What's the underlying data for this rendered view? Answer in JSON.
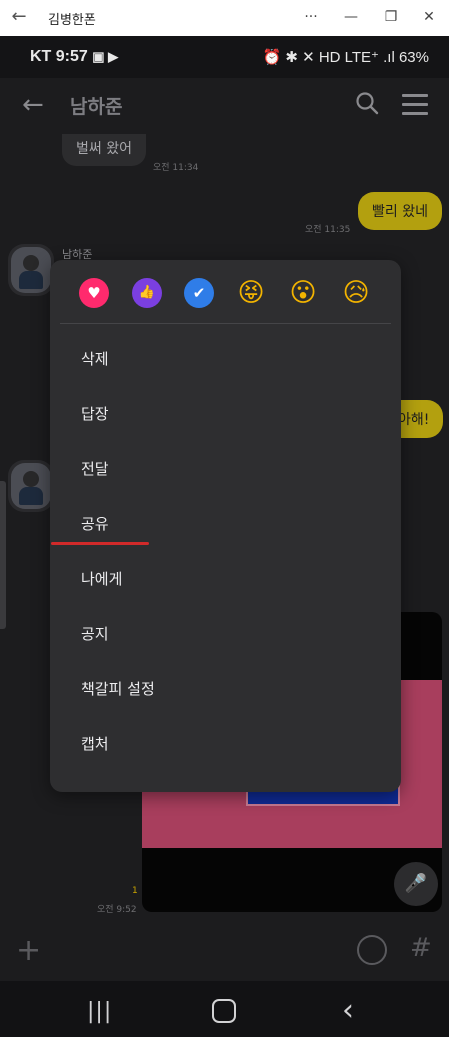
{
  "window": {
    "title": "김병한폰",
    "controls": [
      "···",
      "—",
      "❐",
      "✕"
    ],
    "back_icon": "←"
  },
  "status_bar": {
    "carrier": "KT",
    "time": "9:57",
    "right": "⏰ ✱ ✕ HD LTE⁺ .ıl 63%"
  },
  "chat": {
    "title": "남하준",
    "messages": {
      "left1": {
        "text": "벌써 왔어",
        "time": "오전 11:34"
      },
      "right1": {
        "text": "빨리 왔네",
        "time": "오전 11:35"
      },
      "sender_name": "남하준",
      "right2_partial": "아해!",
      "image_unread": "1",
      "image_time": "오전 9:52"
    }
  },
  "context_menu": {
    "reactions": [
      {
        "name": "heart",
        "glyph": "♥",
        "color": "#ff2a6d"
      },
      {
        "name": "thumbs-up",
        "glyph": "👍",
        "color": "#7b3fe0"
      },
      {
        "name": "check",
        "glyph": "✔",
        "color": "#2f7de8"
      },
      {
        "name": "laugh",
        "glyph": "😝",
        "color": "#f3b400"
      },
      {
        "name": "surprised",
        "glyph": "😮",
        "color": "#f3b400"
      },
      {
        "name": "sad",
        "glyph": "😥",
        "color": "#f3b400"
      }
    ],
    "items": [
      "삭제",
      "답장",
      "전달",
      "공유",
      "나에게",
      "공지",
      "책갈피 설정",
      "캡처"
    ]
  },
  "input_bar": {
    "plus": "+",
    "hash": "#"
  },
  "nav_bar": {
    "recent": "|||",
    "back": "‹"
  },
  "colors": {
    "highlight_underline": "#d12a2a",
    "my_bubble": "#b3a00f"
  }
}
